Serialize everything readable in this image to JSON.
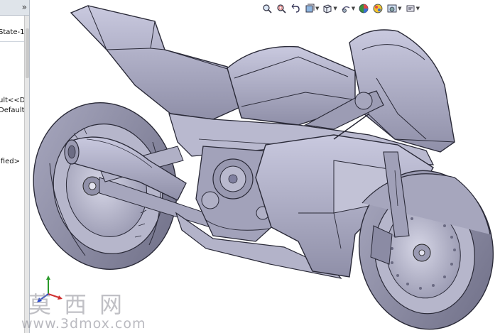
{
  "feature_tree": {
    "rows": [
      {
        "text": "State-1"
      },
      {
        "text": "ult<<De"
      },
      {
        "text": "Default>"
      },
      {
        "text": "ified>"
      }
    ]
  },
  "view_toolbar": {
    "buttons": [
      {
        "icon": "zoom-to-fit-icon"
      },
      {
        "icon": "zoom-to-area-icon"
      },
      {
        "icon": "previous-view-icon"
      },
      {
        "icon": "section-view-icon"
      },
      {
        "icon": "view-orientation-icon"
      },
      {
        "icon": "display-style-icon"
      },
      {
        "icon": "hide-show-items-icon"
      },
      {
        "icon": "edit-appearance-icon"
      },
      {
        "icon": "apply-scene-icon"
      },
      {
        "icon": "view-settings-icon"
      }
    ]
  },
  "watermark": {
    "chinese": "莫西网",
    "url": "www.3dmox.com"
  }
}
